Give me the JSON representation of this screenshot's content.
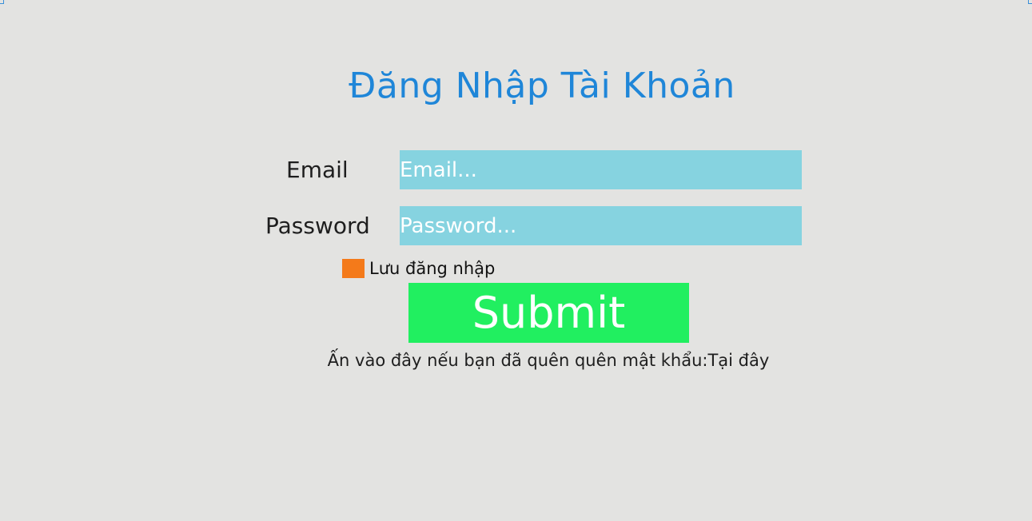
{
  "page": {
    "title": "Đăng Nhập Tài Khoản",
    "title_color": "#1f86d8"
  },
  "form": {
    "email": {
      "label": "Email",
      "placeholder": "Email...",
      "value": ""
    },
    "password": {
      "label": "Password",
      "placeholder": "Password...",
      "value": ""
    },
    "remember": {
      "label": "Lưu đăng nhập",
      "checked": false
    },
    "submit_label": "Submit",
    "forgot_text": "Ấn vào đây nếu bạn đã quên quên mật khẩu:",
    "forgot_link": "Tại đây"
  },
  "colors": {
    "background": "#e3e3e1",
    "input_bg": "#86d3e0",
    "checkbox": "#f47a1a",
    "submit_bg": "#21ef60"
  }
}
